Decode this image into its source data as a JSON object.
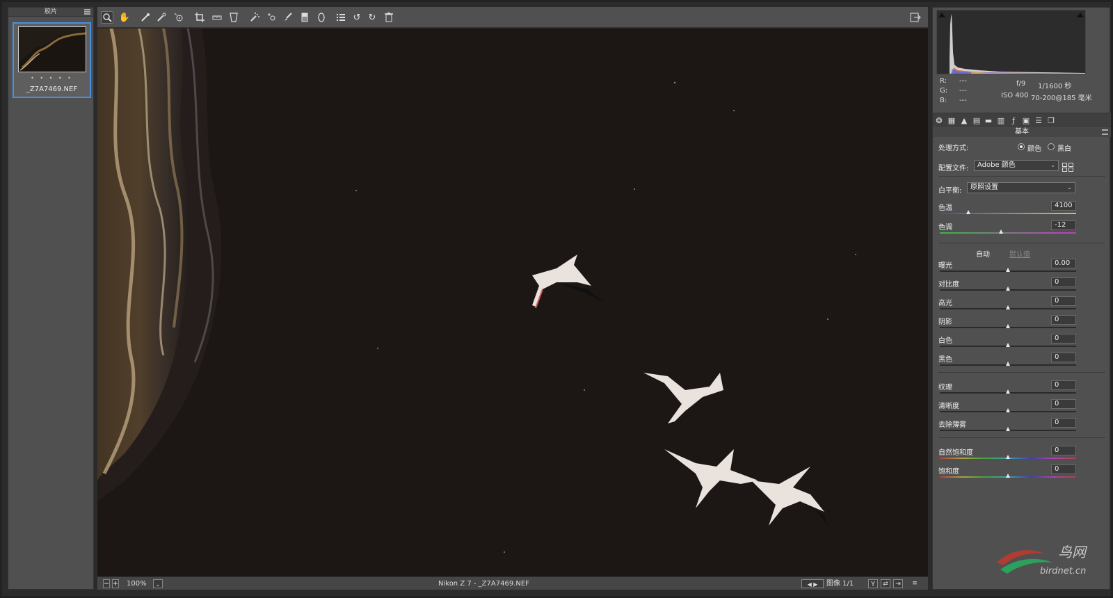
{
  "filmstrip": {
    "title": "胶片",
    "thumb_stars": "• • • • •",
    "thumb_name": "_Z7A7469.NEF"
  },
  "toolbar": {
    "tools": [
      "zoom-icon",
      "hand-icon",
      "white-balance-icon",
      "color-sampler-icon",
      "target-adjust-icon",
      "crop-icon",
      "straighten-icon",
      "transform-icon",
      "spot-removal-icon",
      "red-eye-icon",
      "adjustment-brush-icon",
      "graduated-filter-icon",
      "radial-filter-icon",
      "presets-list-icon",
      "rotate-ccw-icon",
      "rotate-cw-icon",
      "trash-icon"
    ],
    "open_object_icon": "open-object-icon"
  },
  "status": {
    "zoom": "100%",
    "filename": "Nikon Z 7 - _Z7A7469.NEF",
    "image_count": "图像 1/1"
  },
  "readouts": {
    "r_label": "R:",
    "g_label": "G:",
    "b_label": "B:",
    "r_val": "---",
    "g_val": "---",
    "b_val": "---",
    "aperture": "f/9",
    "shutter": "1/1600 秒",
    "iso": "ISO 400",
    "lens": "70-200@185 毫米"
  },
  "panel": {
    "section_title": "基本",
    "treatment_label": "处理方式:",
    "treatment_color": "颜色",
    "treatment_bw": "黑白",
    "profile_label": "配置文件:",
    "profile_value": "Adobe 颜色",
    "wb_label": "白平衡:",
    "wb_value": "原照设置",
    "auto_link": "自动",
    "default_link": "默认值",
    "sliders": [
      {
        "label": "色温",
        "value": "4100",
        "pos": 0.21
      },
      {
        "label": "色调",
        "value": "-12",
        "pos": 0.45
      },
      {
        "label": "曝光",
        "value": "0.00",
        "pos": 0.5
      },
      {
        "label": "对比度",
        "value": "0",
        "pos": 0.5
      },
      {
        "label": "高光",
        "value": "0",
        "pos": 0.5
      },
      {
        "label": "阴影",
        "value": "0",
        "pos": 0.5
      },
      {
        "label": "白色",
        "value": "0",
        "pos": 0.5
      },
      {
        "label": "黑色",
        "value": "0",
        "pos": 0.5
      },
      {
        "label": "纹理",
        "value": "0",
        "pos": 0.5
      },
      {
        "label": "清晰度",
        "value": "0",
        "pos": 0.5
      },
      {
        "label": "去除薄雾",
        "value": "0",
        "pos": 0.5
      },
      {
        "label": "自然饱和度",
        "value": "0",
        "pos": 0.5
      },
      {
        "label": "饱和度",
        "value": "0",
        "pos": 0.5
      }
    ]
  },
  "watermark": {
    "text1": "鸟网",
    "text2": "birdnet.cn"
  }
}
